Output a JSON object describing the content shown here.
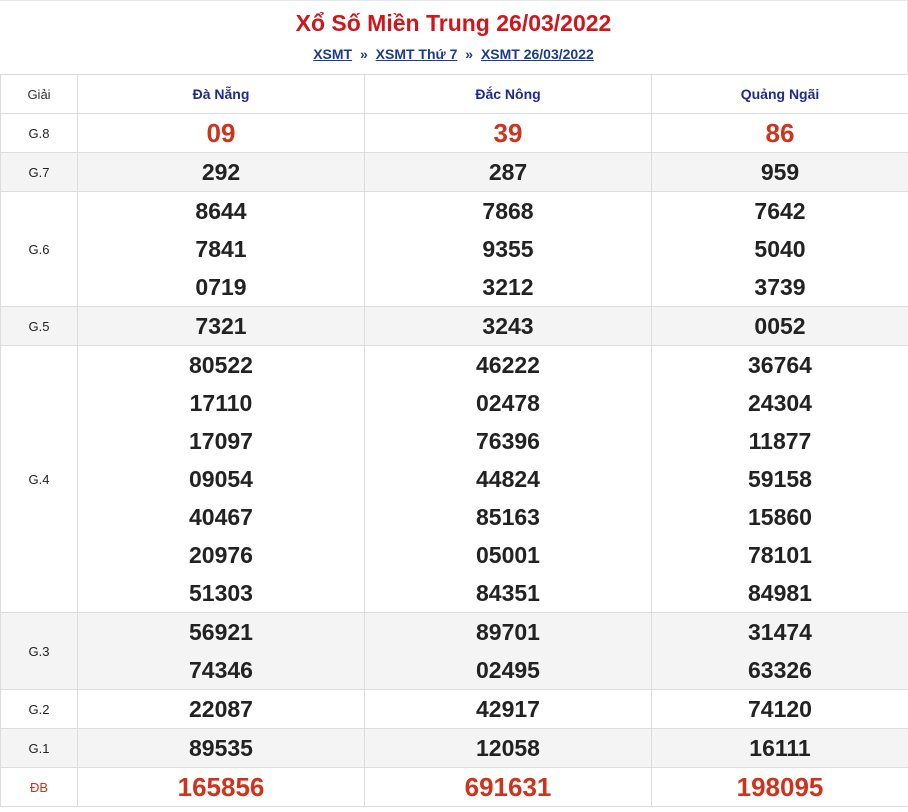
{
  "header": {
    "title": "Xổ Số Miền Trung 26/03/2022",
    "breadcrumb": [
      {
        "label": "XSMT"
      },
      {
        "label": "XSMT Thứ 7"
      },
      {
        "label": "XSMT 26/03/2022"
      }
    ],
    "separator": "»"
  },
  "table": {
    "prize_header": "Giải",
    "provinces": [
      "Đà Nẵng",
      "Đắc Nông",
      "Quảng Ngãi"
    ],
    "rows": [
      {
        "label": "G.8",
        "values": [
          [
            "09"
          ],
          [
            "39"
          ],
          [
            "86"
          ]
        ]
      },
      {
        "label": "G.7",
        "values": [
          [
            "292"
          ],
          [
            "287"
          ],
          [
            "959"
          ]
        ]
      },
      {
        "label": "G.6",
        "values": [
          [
            "8644",
            "7841",
            "0719"
          ],
          [
            "7868",
            "9355",
            "3212"
          ],
          [
            "7642",
            "5040",
            "3739"
          ]
        ]
      },
      {
        "label": "G.5",
        "values": [
          [
            "7321"
          ],
          [
            "3243"
          ],
          [
            "0052"
          ]
        ]
      },
      {
        "label": "G.4",
        "values": [
          [
            "80522",
            "17110",
            "17097",
            "09054",
            "40467",
            "20976",
            "51303"
          ],
          [
            "46222",
            "02478",
            "76396",
            "44824",
            "85163",
            "05001",
            "84351"
          ],
          [
            "36764",
            "24304",
            "11877",
            "59158",
            "15860",
            "78101",
            "84981"
          ]
        ]
      },
      {
        "label": "G.3",
        "values": [
          [
            "56921",
            "74346"
          ],
          [
            "89701",
            "02495"
          ],
          [
            "31474",
            "63326"
          ]
        ]
      },
      {
        "label": "G.2",
        "values": [
          [
            "22087"
          ],
          [
            "42917"
          ],
          [
            "74120"
          ]
        ]
      },
      {
        "label": "G.1",
        "values": [
          [
            "89535"
          ],
          [
            "12058"
          ],
          [
            "16111"
          ]
        ]
      },
      {
        "label": "ĐB",
        "values": [
          [
            "165856"
          ],
          [
            "691631"
          ],
          [
            "198095"
          ]
        ]
      }
    ]
  },
  "colors": {
    "title": "#d0161b",
    "highlight": "#d0321c",
    "link": "#1a3b8f",
    "province": "#1e2a8f"
  }
}
